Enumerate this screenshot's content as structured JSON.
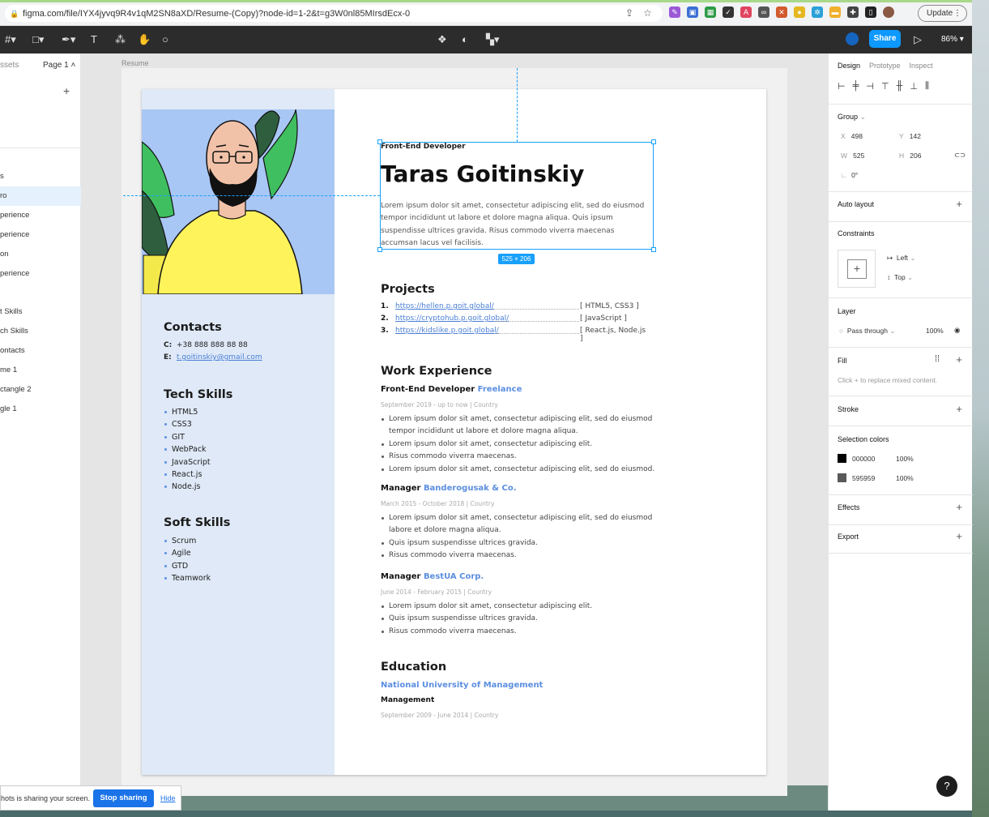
{
  "browser": {
    "url": "figma.com/file/IYX4jyvq9R4v1qM2SN8aXD/Resume-(Copy)?node-id=1-2&t=g3W0nl85MIrsdEcx-0",
    "update_label": "Update"
  },
  "toolbar": {
    "share_label": "Share",
    "zoom": "86%"
  },
  "left_panel": {
    "assets_tab": "ssets",
    "page_label": "Page 1",
    "layers": [
      {
        "label": "s"
      },
      {
        "label": "ro"
      },
      {
        "label": "perience"
      },
      {
        "label": "perience"
      },
      {
        "label": "on"
      },
      {
        "label": "perience"
      },
      {
        "label": "t Skills"
      },
      {
        "label": "ch Skills"
      },
      {
        "label": "ontacts"
      },
      {
        "label": "me 1"
      },
      {
        "label": "ctangle 2"
      },
      {
        "label": "gle 1"
      }
    ]
  },
  "canvas": {
    "frame_label": "Resume",
    "selection_size": "525 × 206"
  },
  "resume": {
    "role": "Front-End Developer",
    "name": "Taras Goitinskiy",
    "intro": "Lorem ipsum dolor sit amet, consectetur adipiscing elit, sed do eiusmod tempor incididunt ut labore et dolore magna aliqua. Quis ipsum suspendisse ultrices gravida. Risus commodo viverra maecenas accumsan lacus vel facilisis.",
    "contacts": {
      "title": "Contacts",
      "phone_label": "C:",
      "phone": "+38 888 888 88 88",
      "email_label": "E:",
      "email": "t.goitinskiy@gmail.com"
    },
    "tech_skills": {
      "title": "Tech Skills",
      "items": [
        "HTML5",
        "CSS3",
        "GIT",
        "WebPack",
        "JavaScript",
        "React.js",
        "Node.js"
      ]
    },
    "soft_skills": {
      "title": "Soft Skills",
      "items": [
        "Scrum",
        "Agile",
        "GTD",
        "Teamwork"
      ]
    },
    "projects": {
      "title": "Projects",
      "items": [
        {
          "num": "1.",
          "link": "https://hellen.p.goit.global/",
          "tags": "[ HTML5, CSS3 ]"
        },
        {
          "num": "2.",
          "link": "https://cryptohub.p.goit.global/",
          "tags": "[ JavaScript ]"
        },
        {
          "num": "3.",
          "link": "https://kidslike.p.goit.global/",
          "tags": "[ React.js, Node.js ]"
        }
      ]
    },
    "work": {
      "title": "Work Experience",
      "jobs": [
        {
          "position": "Front-End Developer",
          "company": "Freelance",
          "meta": "September 2019 - up to now  |  Country",
          "bullets": [
            "Lorem ipsum dolor sit amet, consectetur adipiscing elit, sed do eiusmod tempor incididunt ut labore et dolore magna aliqua.",
            "Lorem ipsum dolor sit amet, consectetur adipiscing elit.",
            "Risus commodo viverra maecenas.",
            "Lorem ipsum dolor sit amet, consectetur adipiscing elit, sed do eiusmod."
          ]
        },
        {
          "position": "Manager",
          "company": "Banderogusak & Co.",
          "meta": "March 2015 - October 2018  |  Country",
          "bullets": [
            "Lorem ipsum dolor sit amet, consectetur adipiscing elit, sed do eiusmod labore et dolore magna aliqua.",
            "Quis ipsum suspendisse ultrices gravida.",
            "Risus commodo viverra maecenas."
          ]
        },
        {
          "position": "Manager",
          "company": "BestUA Corp.",
          "meta": "June 2014 - February 2015  |  Country",
          "bullets": [
            "Lorem ipsum dolor sit amet, consectetur adipiscing elit.",
            "Quis ipsum suspendisse ultrices gravida.",
            "Risus commodo viverra maecenas."
          ]
        }
      ]
    },
    "education": {
      "title": "Education",
      "school": "National University of Management",
      "degree": "Management",
      "meta": "September 2009 - June 2014  |  Country"
    }
  },
  "right_panel": {
    "tabs": [
      "Design",
      "Prototype",
      "Inspect"
    ],
    "group_label": "Group",
    "x_label": "X",
    "x_value": "498",
    "y_label": "Y",
    "y_value": "142",
    "w_label": "W",
    "w_value": "525",
    "h_label": "H",
    "h_value": "206",
    "rotation": "0°",
    "auto_layout": "Auto layout",
    "constraints": "Constraints",
    "constraint_h": "Left",
    "constraint_v": "Top",
    "layer": "Layer",
    "blend_mode": "Pass through",
    "opacity": "100%",
    "fill": "Fill",
    "fill_hint": "Click + to replace mixed content.",
    "stroke": "Stroke",
    "selection_colors": "Selection colors",
    "colors": [
      {
        "hex": "000000",
        "opacity": "100%",
        "swatch": "#000000"
      },
      {
        "hex": "595959",
        "opacity": "100%",
        "swatch": "#595959"
      }
    ],
    "effects": "Effects",
    "export": "Export"
  },
  "share_bar": {
    "text": "hots is sharing your screen.",
    "stop_label": "Stop sharing",
    "hide_label": "Hide"
  }
}
